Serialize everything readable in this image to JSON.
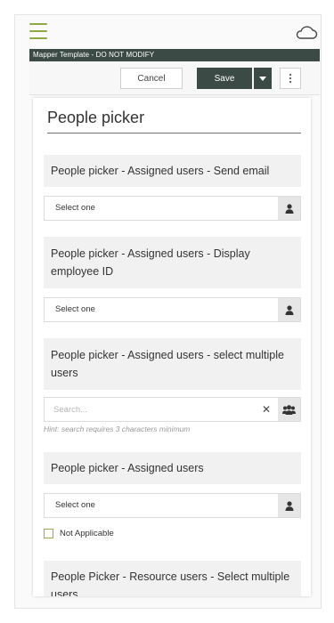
{
  "template_name": "Mapper Template - DO NOT MODIFY",
  "toolbar": {
    "cancel_label": "Cancel",
    "save_label": "Save"
  },
  "form": {
    "title": "People picker",
    "questions": [
      {
        "label": "People picker - Assigned users - Send email",
        "select_value": "Select one"
      },
      {
        "label": "People picker - Assigned users - Display employee ID",
        "select_value": "Select one"
      },
      {
        "label": "People picker - Assigned users - select multiple users",
        "search_placeholder": "Search...",
        "hint": "Hint: search requires 3 characters minimum"
      },
      {
        "label": "People picker - Assigned users",
        "select_value": "Select one",
        "not_applicable_label": "Not Applicable"
      },
      {
        "label": "People Picker - Resource users - Select multiple users"
      }
    ]
  },
  "colors": {
    "accent_green": "#8fa847",
    "dark_header": "#3b4a45"
  }
}
